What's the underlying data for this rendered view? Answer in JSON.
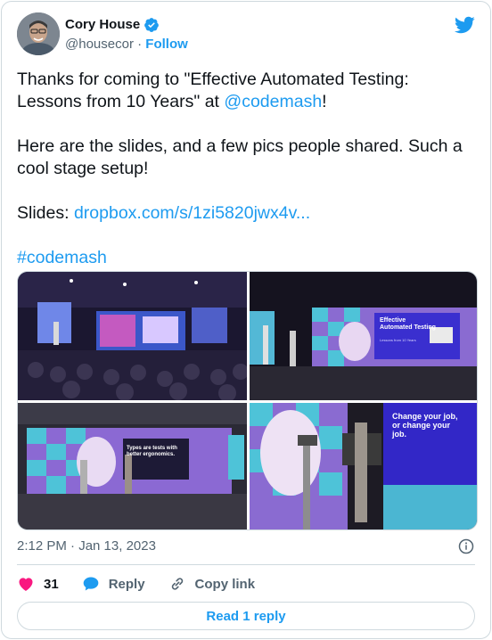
{
  "author": {
    "name": "Cory House",
    "handle": "@housecor",
    "separator": "·",
    "follow_label": "Follow"
  },
  "tweet": {
    "line1_prefix": "Thanks for coming to \"Effective Automated Testing: Lessons from 10 Years\" at ",
    "mention": "@codemash",
    "line1_suffix": "!",
    "line2": "Here are the slides, and a few pics people shared. Such a cool stage setup!",
    "slides_label": "Slides: ",
    "slides_link": "dropbox.com/s/1zi5820jwx4v...",
    "hashtag": "#codemash"
  },
  "media": {
    "photo2_slide_title": "Effective Automated Testing",
    "photo2_slide_subtitle": "Lessons from 10 Years",
    "photo3_slide_text": "Types are tests with better ergonomics.",
    "photo4_slide_text": "Change your job, or change your job."
  },
  "meta": {
    "timestamp": "2:12 PM · Jan 13, 2023"
  },
  "actions": {
    "likes": "31",
    "reply_label": "Reply",
    "copy_label": "Copy link"
  },
  "footer": {
    "read_reply_label": "Read 1 reply"
  },
  "colors": {
    "accent": "#1d9bf0",
    "heart": "#f91880",
    "muted": "#536471",
    "border": "#cfd9de"
  },
  "icons": [
    "verified-badge-icon",
    "twitter-bird-icon",
    "info-icon",
    "heart-icon",
    "reply-bubble-icon",
    "link-icon"
  ]
}
